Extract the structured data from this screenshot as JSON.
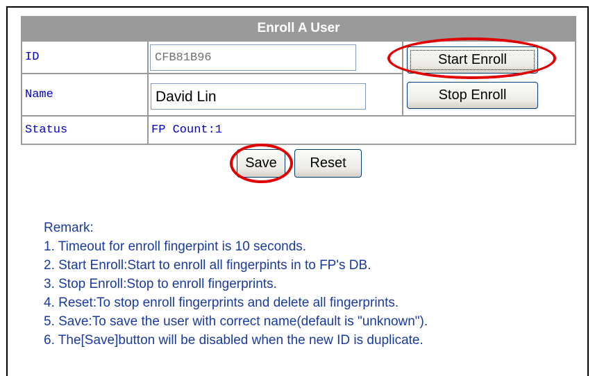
{
  "form": {
    "title": "Enroll A User",
    "id_label": "ID",
    "id_value": "CFB81B96",
    "name_label": "Name",
    "name_value": "David Lin",
    "status_label": "Status",
    "status_value": "FP Count:1",
    "start_enroll_label": "Start Enroll",
    "stop_enroll_label": "Stop Enroll",
    "save_label": "Save",
    "reset_label": "Reset"
  },
  "remarks": {
    "heading": "Remark:",
    "items": [
      "1. Timeout for enroll fingerpint is 10 seconds.",
      "2. Start Enroll:Start to enroll all fingerpints in to FP's DB.",
      "3. Stop Enroll:Stop to enroll fingerprints.",
      "4. Reset:To stop enroll fingerprints and delete all fingerprints.",
      "5. Save:To save the user with correct name(default is \"unknown\").",
      "6. The[Save]button will be disabled when the new ID is duplicate."
    ]
  },
  "colors": {
    "header_bg": "#9a9a9a",
    "label_text": "#0000c8",
    "remark_text": "#1a3aa0",
    "highlight_ring": "#e00000"
  }
}
